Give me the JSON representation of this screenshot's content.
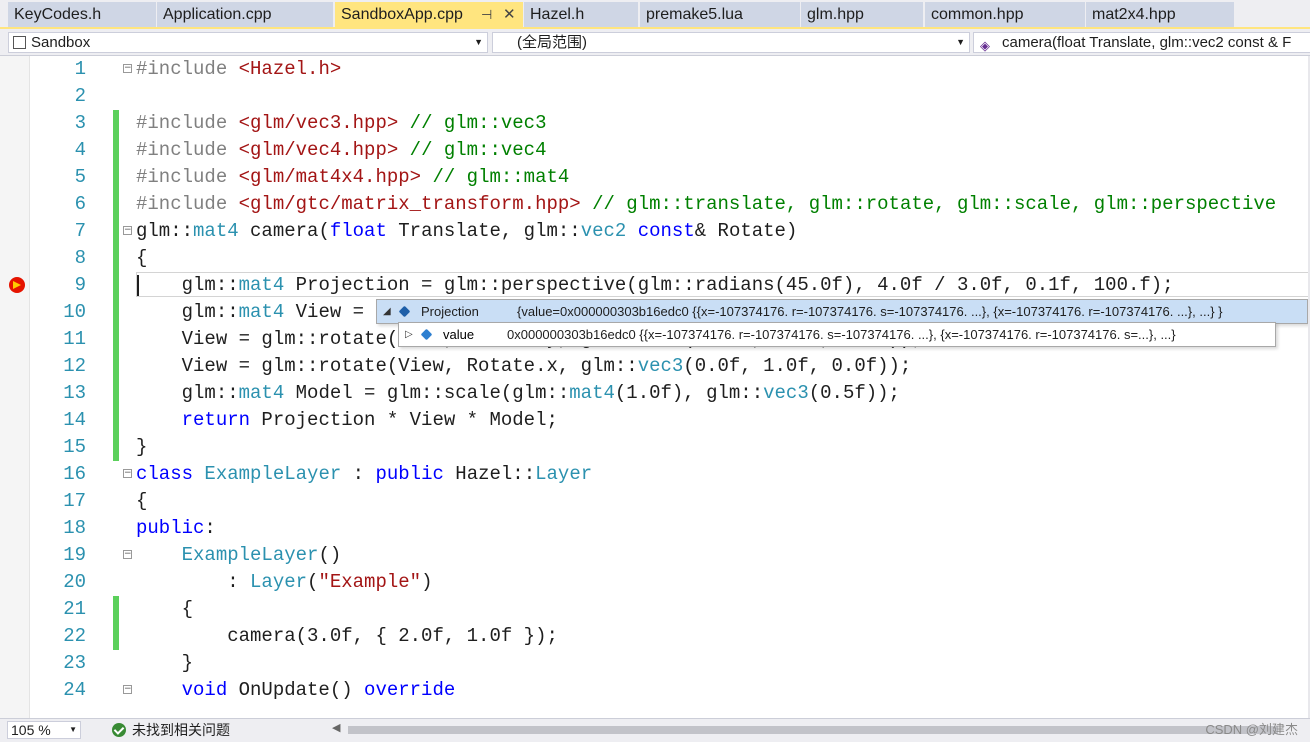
{
  "tabs": [
    {
      "label": "KeyCodes.h",
      "active": false
    },
    {
      "label": "Application.cpp",
      "active": false
    },
    {
      "label": "SandboxApp.cpp",
      "active": true
    },
    {
      "label": "Hazel.h",
      "active": false
    },
    {
      "label": "premake5.lua",
      "active": false
    },
    {
      "label": "glm.hpp",
      "active": false
    },
    {
      "label": "common.hpp",
      "active": false
    },
    {
      "label": "mat2x4.hpp",
      "active": false
    }
  ],
  "navbar": {
    "project": "Sandbox",
    "scope": "(全局范围)",
    "member": "camera(float Translate, glm::vec2 const & F"
  },
  "line_numbers": [
    "1",
    "2",
    "3",
    "4",
    "5",
    "6",
    "7",
    "8",
    "9",
    "10",
    "11",
    "12",
    "13",
    "14",
    "15",
    "16",
    "17",
    "18",
    "19",
    "20",
    "21",
    "22",
    "23",
    "24"
  ],
  "code_lines": [
    "#include <Hazel.h>",
    "",
    "#include <glm/vec3.hpp> // glm::vec3",
    "#include <glm/vec4.hpp> // glm::vec4",
    "#include <glm/mat4x4.hpp> // glm::mat4",
    "#include <glm/gtc/matrix_transform.hpp> // glm::translate, glm::rotate, glm::scale, glm::perspective",
    "glm::mat4 camera(float Translate, glm::vec2 const& Rotate)",
    "{",
    "    glm::mat4 Projection = glm::perspective(glm::radians(45.0f), 4.0f / 3.0f, 0.1f, 100.f);",
    "    glm::mat4 View = glm::translate(glm::mat4(1.0f), glm::vec3(0.0f, 0.0f, -Translate));",
    "    View = glm::rotate(View, Rotate.y, glm::vec3(-1.0f, 0.0f, 0.0f));",
    "    View = glm::rotate(View, Rotate.x, glm::vec3(0.0f, 1.0f, 0.0f));",
    "    glm::mat4 Model = glm::scale(glm::mat4(1.0f), glm::vec3(0.5f));",
    "    return Projection * View * Model;",
    "}",
    "class ExampleLayer : public Hazel::Layer",
    "{",
    "public:",
    "    ExampleLayer()",
    "        : Layer(\"Example\")",
    "    {",
    "        camera(3.0f, { 2.0f, 1.0f });",
    "    }",
    "    void OnUpdate() override"
  ],
  "datatip": {
    "name": "Projection",
    "value": "{value=0x000000303b16edc0 {{x=-107374176. r=-107374176. s=-107374176. ...}, {x=-107374176. r=-107374176. ...}, ...} }",
    "child_name": "value",
    "child_value": "0x000000303b16edc0 {{x=-107374176. r=-107374176. s=-107374176. ...}, {x=-107374176. r=-107374176. s=...}, ...}"
  },
  "status": {
    "zoom": "105 %",
    "issues": "未找到相关问题",
    "watermark": "CSDN @刘建杰"
  },
  "colors": {
    "active_tab": "#ffe57f",
    "change_bar": "#5bd05b",
    "breakpoint": "#e51400",
    "keyword": "#0000ff",
    "type": "#2b91af",
    "string": "#a31515",
    "comment": "#008000"
  },
  "icons": {
    "breakpoint_arrow": "current-statement-icon",
    "ok": "check-circle-icon",
    "object": "object-icon"
  }
}
